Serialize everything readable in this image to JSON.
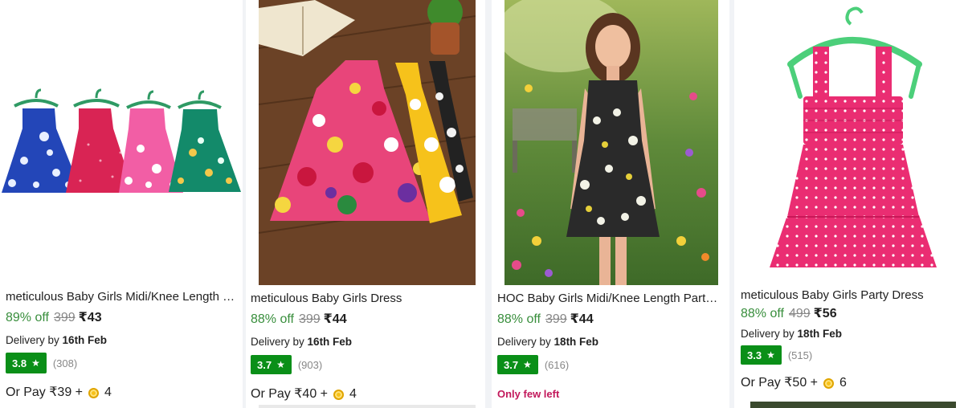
{
  "products": [
    {
      "title": "meticulous Baby Girls Midi/Knee Length Dress",
      "discount": "89% off",
      "mrp": "399",
      "price": "₹43",
      "delivery_prefix": "Delivery by",
      "delivery_date": "16th Feb",
      "rating": "3.8",
      "rating_count": "(308)",
      "pay_text": "Or Pay ₹39 +",
      "coins": "4",
      "image_icon": "four-dresses-on-hangers-photo"
    },
    {
      "title": "meticulous Baby Girls Dress",
      "discount": "88% off",
      "mrp": "399",
      "price": "₹44",
      "delivery_prefix": "Delivery by",
      "delivery_date": "16th Feb",
      "rating": "3.7",
      "rating_count": "(903)",
      "pay_text": "Or Pay ₹40 +",
      "coins": "4",
      "image_icon": "dresses-on-table-photo"
    },
    {
      "title": "HOC Baby Girls Midi/Knee Length Party Dress",
      "discount": "88% off",
      "mrp": "399",
      "price": "₹44",
      "delivery_prefix": "Delivery by",
      "delivery_date": "18th Feb",
      "rating": "3.7",
      "rating_count": "(616)",
      "stock_note": "Only few left",
      "image_icon": "model-in-garden-photo"
    },
    {
      "title": "meticulous Baby Girls Party Dress",
      "discount": "88% off",
      "mrp": "499",
      "price": "₹56",
      "delivery_prefix": "Delivery by",
      "delivery_date": "18th Feb",
      "rating": "3.3",
      "rating_count": "(515)",
      "pay_text": "Or Pay ₹50 +",
      "coins": "6",
      "image_icon": "pink-polka-dress-photo"
    }
  ],
  "colors": {
    "discount_green": "#388e3c",
    "rating_badge": "#0a8f18",
    "stock_warning": "#c2185b",
    "coin": "#f7c21a"
  }
}
